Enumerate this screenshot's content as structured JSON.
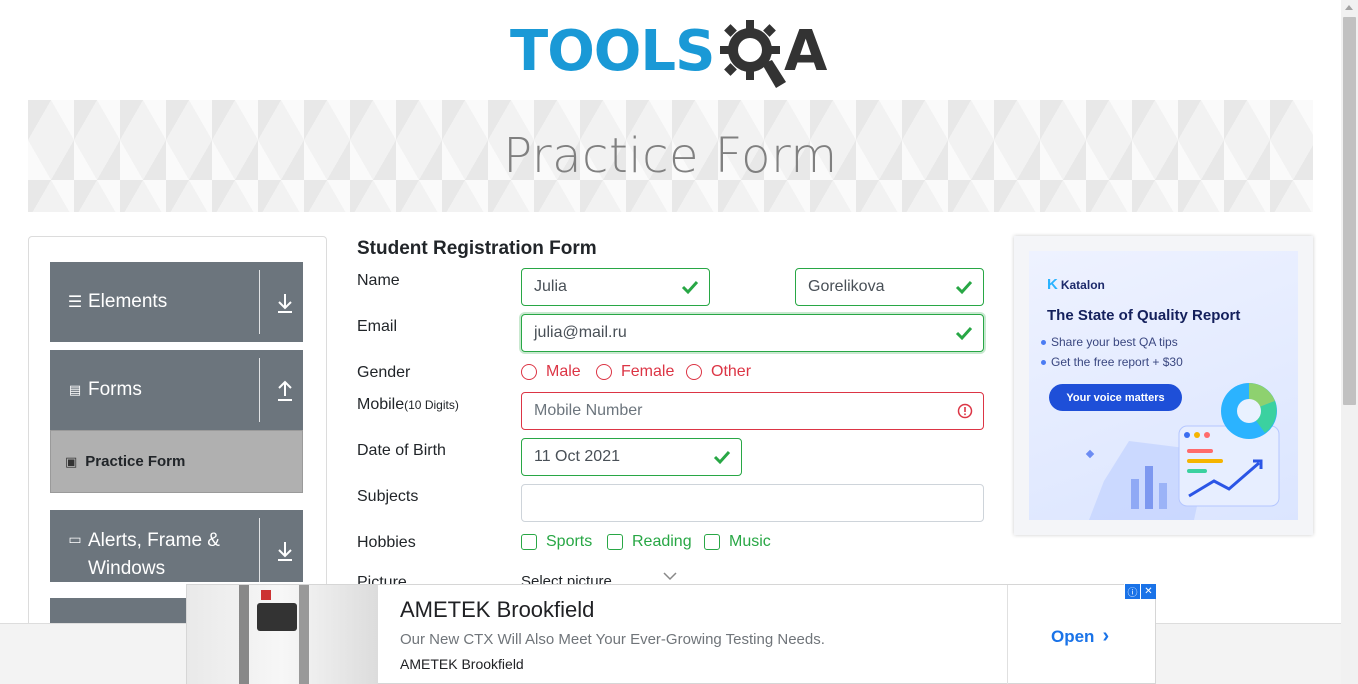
{
  "logo": {
    "text": "TOOLS",
    "suffix": "A"
  },
  "banner": {
    "title": "Practice Form"
  },
  "sidebar": {
    "groups": [
      {
        "label": "Elements",
        "icon": "hamburger-icon",
        "arrow": "download-arrow-icon"
      },
      {
        "label": "Forms",
        "icon": "document-icon",
        "arrow": "upload-arrow-icon"
      },
      {
        "label": "Alerts, Frame & Windows",
        "icon": "window-icon",
        "arrow": "download-arrow-icon"
      }
    ],
    "active_item": {
      "label": "Practice Form",
      "icon": "form-icon"
    }
  },
  "form": {
    "title": "Student Registration Form",
    "labels": {
      "name": "Name",
      "email": "Email",
      "gender": "Gender",
      "mobile": "Mobile",
      "mobile_hint": "(10 Digits)",
      "dob": "Date of Birth",
      "subjects": "Subjects",
      "hobbies": "Hobbies",
      "picture": "Picture"
    },
    "first_name": "Julia",
    "last_name": "Gorelikova",
    "email": "julia@mail.ru",
    "mobile_placeholder": "Mobile Number",
    "dob": "11 Oct 2021",
    "subjects": "",
    "gender_options": [
      "Male",
      "Female",
      "Other"
    ],
    "hobby_options": [
      "Sports",
      "Reading",
      "Music"
    ],
    "picture_button": "Select picture"
  },
  "side_ad": {
    "brand": "Katalon",
    "title": "The State of Quality Report",
    "bullets": [
      "Share your best QA tips",
      "Get the free report + $30"
    ],
    "button": "Your voice matters"
  },
  "bottom_ad": {
    "title": "AMETEK Brookfield",
    "description": "Our New CTX Will Also Meet Your Ever-Growing Testing Needs.",
    "brand": "AMETEK Brookfield",
    "cta": "Open"
  },
  "colors": {
    "valid": "#28a745",
    "invalid": "#dc3545",
    "sidebar_group": "#6c757d",
    "logo_blue": "#1a99d6"
  }
}
